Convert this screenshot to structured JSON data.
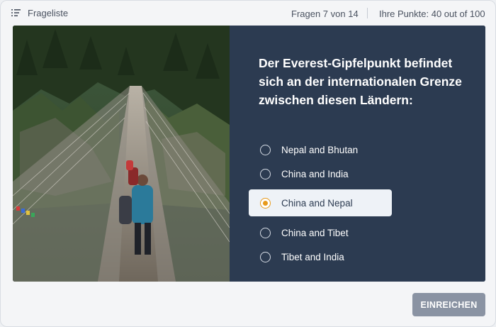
{
  "header": {
    "question_list_label": "Frageliste",
    "question_list_icon": "list-icon",
    "progress_text": "Fragen 7 von 14",
    "score_text": "Ihre Punkte: 40 out of 100"
  },
  "question": {
    "text": "Der Everest-Gipfelpunkt befindet sich an der internationalen Grenze zwischen diesen Ländern:",
    "image_description_icon": "suspension-bridge-photo",
    "options": [
      {
        "label": "Nepal and Bhutan",
        "selected": false
      },
      {
        "label": "China and India",
        "selected": false
      },
      {
        "label": "China and Nepal",
        "selected": true
      },
      {
        "label": "China and Tibet",
        "selected": false
      },
      {
        "label": "Tibet and India",
        "selected": false
      }
    ]
  },
  "footer": {
    "submit_label": "EINREICHEN"
  },
  "colors": {
    "panel": "#2c3b51",
    "accent": "#e79a1b",
    "button": "#8a93a3"
  }
}
